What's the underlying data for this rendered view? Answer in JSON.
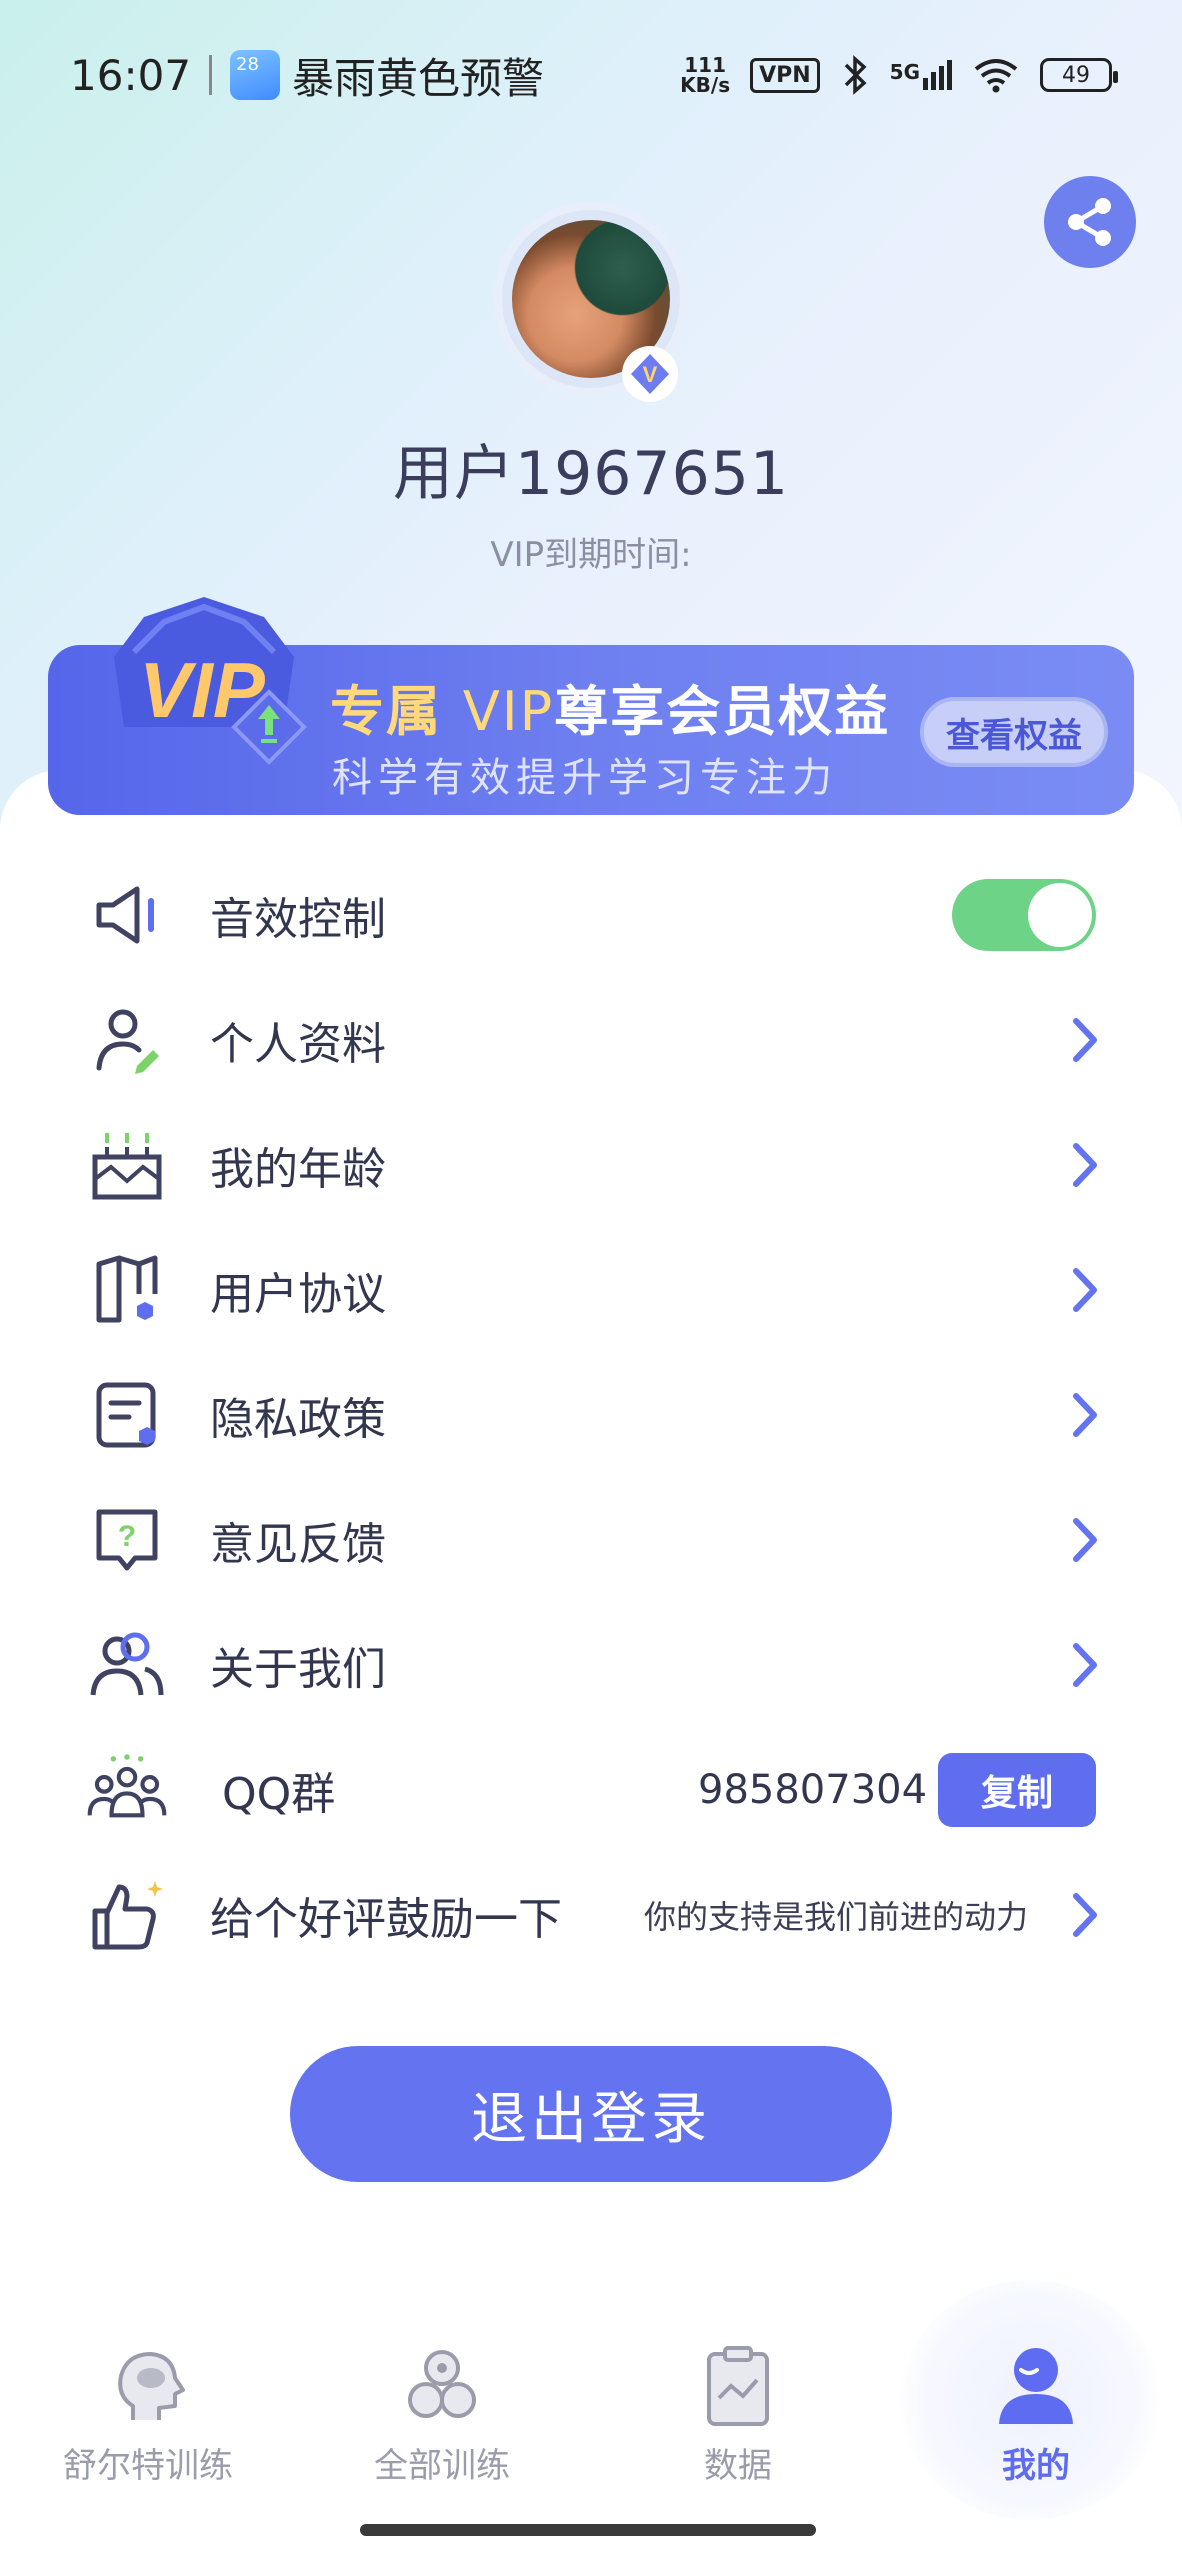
{
  "status_bar": {
    "time": "16:07",
    "weather_badge": "28",
    "alert": "暴雨黄色预警",
    "net_speed_value": "111",
    "net_speed_unit": "KB/s",
    "vpn": "VPN",
    "signal": "5G",
    "battery": "49"
  },
  "profile": {
    "username": "用户1967651",
    "vip_expire_label": "VIP到期时间:",
    "avatar_badge": "V"
  },
  "vip_banner": {
    "crown_text": "VIP",
    "title_prefix": "专属",
    "title_vip": "VIP",
    "title_suffix": "尊享会员权益",
    "subtitle": "科学有效提升学习专注力",
    "button": "查看权益"
  },
  "menu": {
    "sound": "音效控制",
    "sound_enabled": true,
    "profile": "个人资料",
    "age": "我的年龄",
    "agreement": "用户协议",
    "privacy": "隐私政策",
    "feedback": "意见反馈",
    "about": "关于我们",
    "qq_group": "QQ群",
    "qq_number": "985807304",
    "copy": "复制",
    "review": "给个好评鼓励一下",
    "review_hint": "你的支持是我们前进的动力"
  },
  "logout": "退出登录",
  "tabs": {
    "schulte": "舒尔特训练",
    "all": "全部训练",
    "data": "数据",
    "mine": "我的"
  },
  "colors": {
    "primary": "#6473ef",
    "toggle_on": "#6dd487",
    "vip_gold": "#ffd97a"
  }
}
